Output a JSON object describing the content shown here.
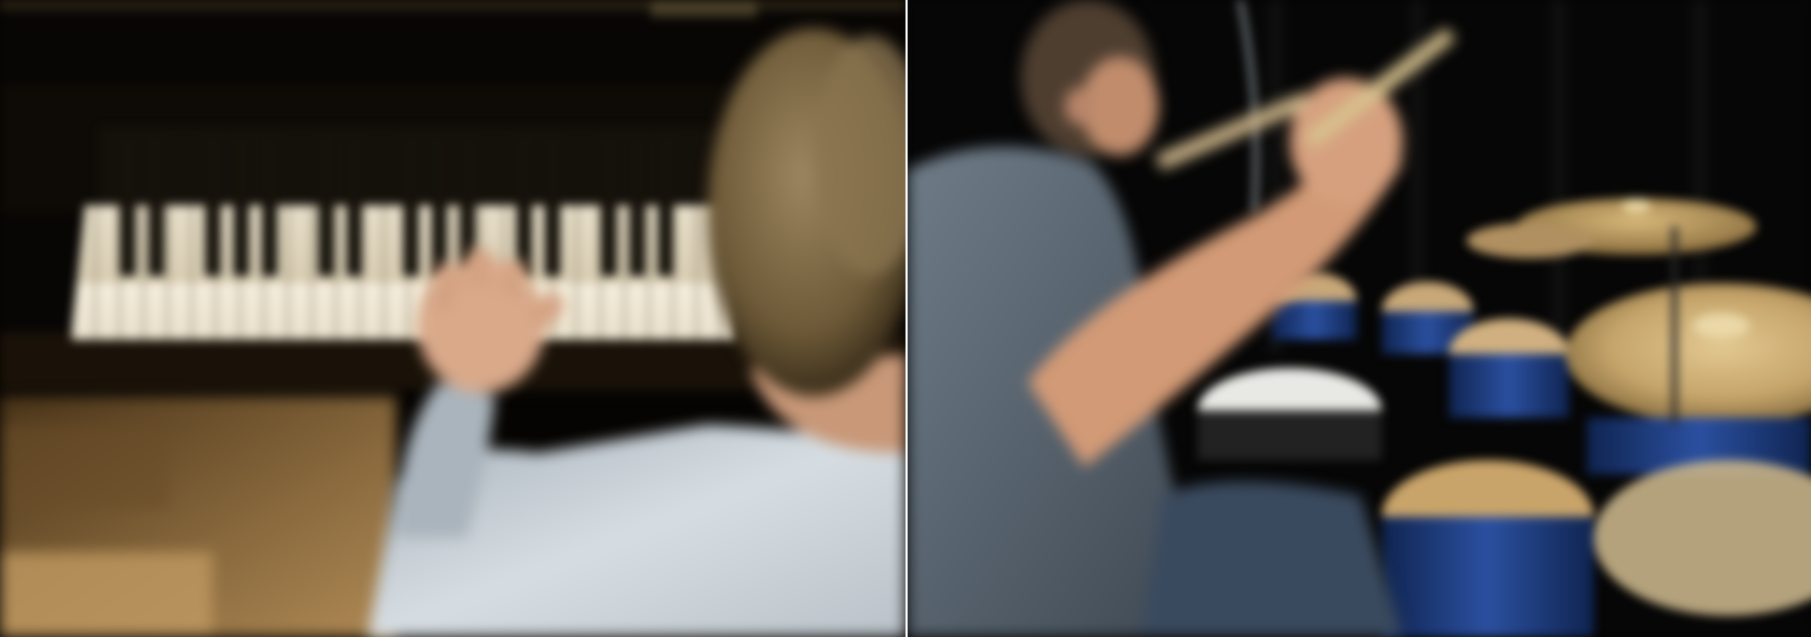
{
  "scene": {
    "left_panel": "piano-player",
    "right_panel": "drummer"
  },
  "colors": {
    "background": "#000000",
    "divider": "#ffffff",
    "piano_keys_white": "#efe6d2",
    "piano_keys_black": "#121008",
    "hair": "#7a6440",
    "skin": "#d9a98a",
    "left_shirt": "#c7d0d6",
    "right_shirt": "#55616e",
    "drum_shell_blue": "#1c3a78",
    "cymbal_gold": "#c5a46a",
    "drum_head": "#e8e8e4",
    "wood_floor": "#8a6a3e"
  }
}
